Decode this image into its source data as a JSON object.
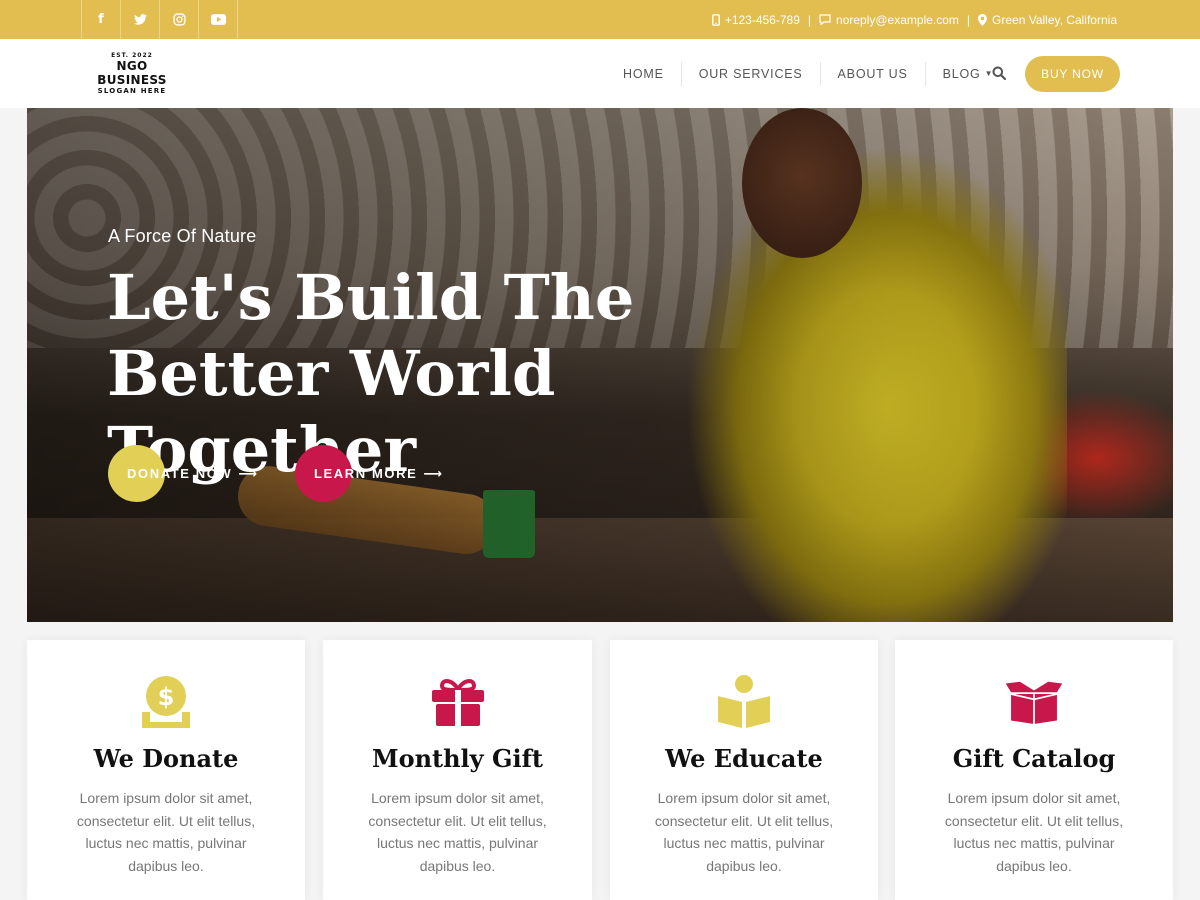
{
  "topbar": {
    "social": [
      {
        "icon": "facebook-icon",
        "glyph": "f"
      },
      {
        "icon": "twitter-icon",
        "glyph": "t"
      },
      {
        "icon": "instagram-icon",
        "glyph": "◎"
      },
      {
        "icon": "youtube-icon",
        "glyph": "▶"
      }
    ],
    "phone": "+123-456-789",
    "email": "noreply@example.com",
    "location": "Green Valley, California"
  },
  "header": {
    "logo_est": "EST. 2022",
    "logo_name": "NGO BUSINESS",
    "logo_slogan": "SLOGAN HERE",
    "nav": [
      "HOME",
      "OUR SERVICES",
      "ABOUT US",
      "BLOG"
    ],
    "buy_now": "BUY NOW"
  },
  "hero": {
    "subtitle": "A Force Of Nature",
    "title": "Let's Build The Better World Together",
    "donate_label": "DONATE NOW",
    "learn_label": "LEARN MORE",
    "arrow": "⟶"
  },
  "cards": [
    {
      "title": "We Donate",
      "text": "Lorem ipsum dolor sit amet, consectetur elit. Ut elit tellus, luctus nec mattis, pulvinar dapibus leo.",
      "icon": "donate-coin-icon",
      "color": "#e2cf55"
    },
    {
      "title": "Monthly Gift",
      "text": "Lorem ipsum dolor sit amet, consectetur elit. Ut elit tellus, luctus nec mattis, pulvinar dapibus leo.",
      "icon": "gift-icon",
      "color": "#c8174a"
    },
    {
      "title": "We Educate",
      "text": "Lorem ipsum dolor sit amet, consectetur elit. Ut elit tellus, luctus nec mattis, pulvinar dapibus leo.",
      "icon": "book-reader-icon",
      "color": "#e2cf55"
    },
    {
      "title": "Gift Catalog",
      "text": "Lorem ipsum dolor sit amet, consectetur elit. Ut elit tellus, luctus nec mattis, pulvinar dapibus leo.",
      "icon": "open-box-icon",
      "color": "#c8174a"
    }
  ],
  "colors": {
    "accent": "#e2bd4f",
    "primary_yellow": "#e2cf55",
    "primary_magenta": "#c8174a"
  }
}
